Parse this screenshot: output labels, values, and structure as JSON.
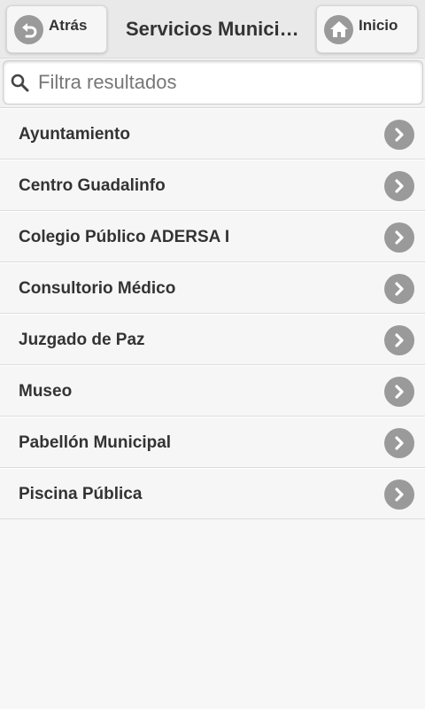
{
  "header": {
    "back_label": "Atrás",
    "title": "Servicios Municipales",
    "home_label": "Inicio"
  },
  "search": {
    "placeholder": "Filtra resultados",
    "value": ""
  },
  "list": {
    "items": [
      {
        "label": "Ayuntamiento"
      },
      {
        "label": "Centro Guadalinfo"
      },
      {
        "label": "Colegio Público ADERSA I"
      },
      {
        "label": "Consultorio Médico"
      },
      {
        "label": "Juzgado de Paz"
      },
      {
        "label": "Museo"
      },
      {
        "label": "Pabellón Municipal"
      },
      {
        "label": "Piscina Pública"
      }
    ]
  },
  "icons": {
    "back": "undo-arrow-icon",
    "home": "home-icon",
    "search": "search-icon",
    "item": "chevron-right-icon"
  },
  "colors": {
    "icon_disc": "#9a9a9a",
    "header_bg": "#e9e9e9",
    "text": "#333333"
  }
}
